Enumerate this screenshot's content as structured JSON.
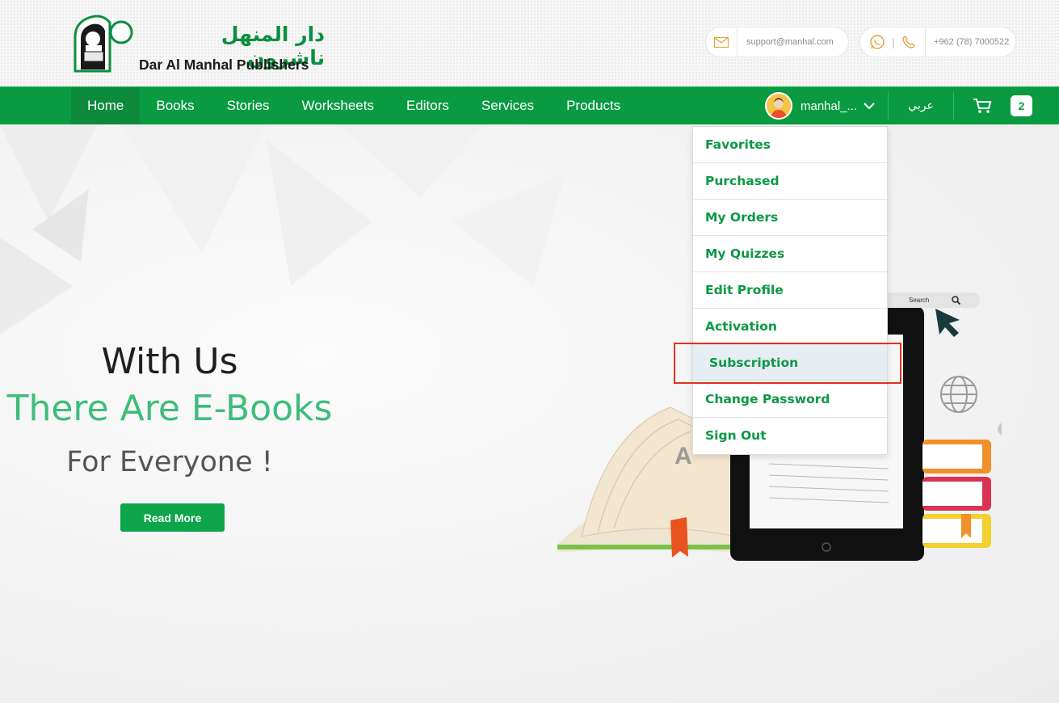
{
  "header": {
    "logo_arabic": "دار المنهل ناشرون",
    "logo_english": "Dar Al Manhal Publishers",
    "email": "support@manhal.com",
    "phone": "+962 (78) 7000522",
    "phone_separator": "|"
  },
  "nav": {
    "items": [
      {
        "label": "Home",
        "active": true
      },
      {
        "label": "Books"
      },
      {
        "label": "Stories"
      },
      {
        "label": "Worksheets"
      },
      {
        "label": "Editors"
      },
      {
        "label": "Services"
      },
      {
        "label": "Products"
      }
    ],
    "username": "manhal_...",
    "language": "عربي",
    "cart_count": "2"
  },
  "dropdown": {
    "items": [
      "Favorites",
      "Purchased",
      "My Orders",
      "My Quizzes",
      "Edit Profile",
      "Activation",
      "Subscription",
      "Change Password",
      "Sign Out"
    ],
    "highlighted": "Subscription"
  },
  "hero": {
    "line1": "With Us",
    "line2": "There Are E-Books",
    "line3": "For Everyone !",
    "button": "Read More",
    "search_label": "Search"
  },
  "colors": {
    "brand_green": "#0a9b42",
    "accent_green": "#3ebd7a",
    "highlight_border": "#e0321f"
  },
  "icons": [
    "logo-emblem-icon",
    "mail-icon",
    "whatsapp-icon",
    "phone-icon",
    "avatar-icon",
    "chevron-down-icon",
    "cart-icon",
    "search-icon",
    "globe-icon",
    "cloud-download-icon",
    "cursor-arrow-icon"
  ]
}
